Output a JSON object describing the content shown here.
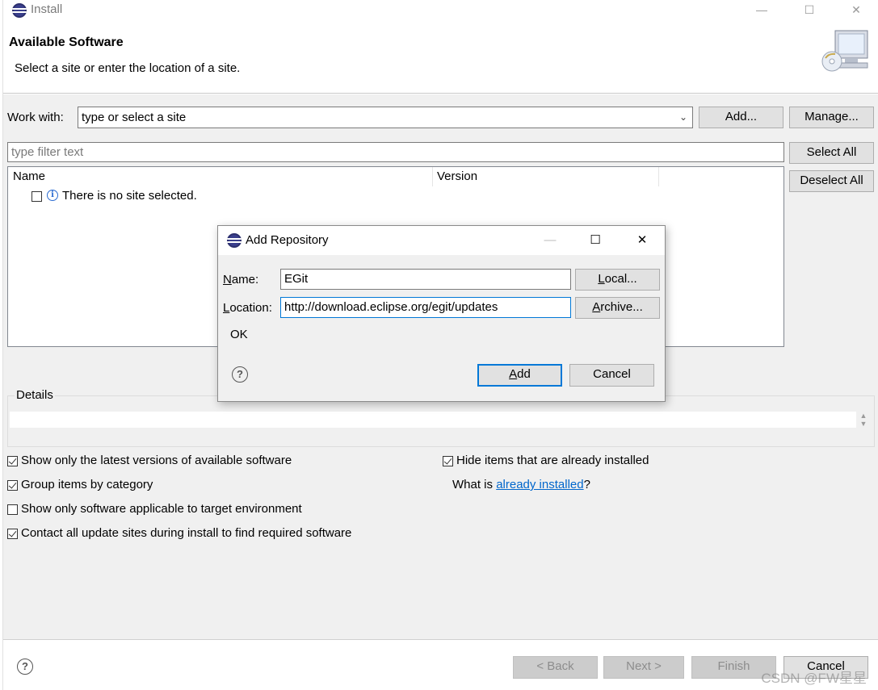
{
  "window": {
    "title": "Install",
    "controls": [
      "—",
      "☐",
      "✕"
    ]
  },
  "header": {
    "title": "Available Software",
    "subtitle": "Select a site or enter the location of a site."
  },
  "work_with": {
    "label": "Work with:",
    "value": "type or select a site",
    "add_label": "Add...",
    "manage_label": "Manage..."
  },
  "filter": {
    "placeholder": "type filter text"
  },
  "selection": {
    "select_all": "Select All",
    "deselect_all": "Deselect All"
  },
  "table": {
    "columns": [
      "Name",
      "Version"
    ],
    "rows": [
      {
        "text": "There is no site selected.",
        "checked": false
      }
    ]
  },
  "details": {
    "label": "Details"
  },
  "options": {
    "show_latest": {
      "label": "Show only the latest versions of available software",
      "checked": true
    },
    "group_by_category": {
      "label": "Group items by category",
      "checked": true
    },
    "applicable_only": {
      "label": "Show only software applicable to target environment",
      "checked": false
    },
    "contact_sites": {
      "label": "Contact all update sites during install to find required software",
      "checked": true
    },
    "hide_installed": {
      "label": "Hide items that are already installed",
      "checked": true
    },
    "what_is_prefix": "What is ",
    "what_is_link": "already installed",
    "what_is_suffix": "?"
  },
  "footer": {
    "back": "< Back",
    "next": "Next >",
    "finish": "Finish",
    "cancel": "Cancel"
  },
  "dialog": {
    "title": "Add Repository",
    "name_label_u": "N",
    "name_label_rest": "ame:",
    "name_value": "EGit",
    "location_label_u": "L",
    "location_label_rest": "ocation:",
    "location_value": "http://download.eclipse.org/egit/updates",
    "local_u": "L",
    "local_rest": "ocal...",
    "archive_u": "A",
    "archive_rest": "rchive...",
    "status": "OK",
    "add_u": "A",
    "add_rest": "dd",
    "cancel": "Cancel"
  },
  "watermark": "CSDN @FW星星"
}
